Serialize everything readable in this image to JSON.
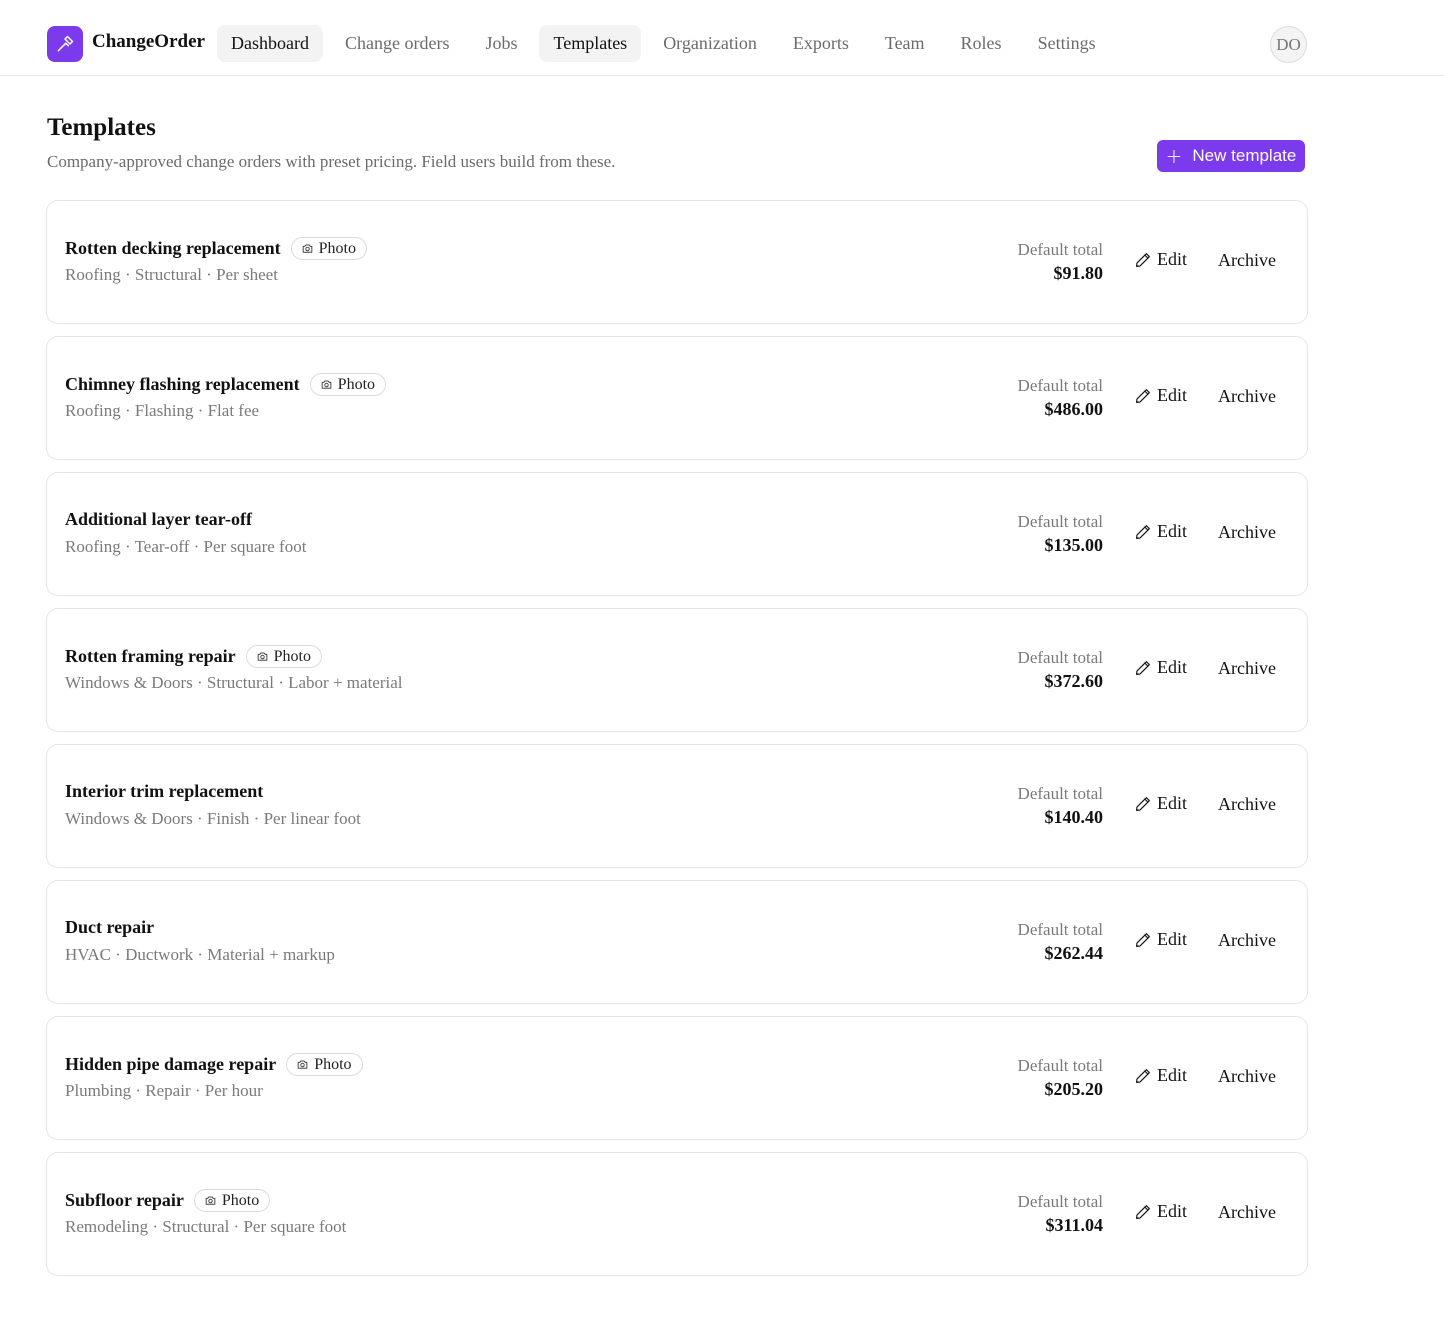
{
  "brand": {
    "name": "ChangeOrder",
    "logo_icon": "hammer-icon",
    "accent": "#7c3aed"
  },
  "nav": [
    {
      "label": "Dashboard",
      "active": true
    },
    {
      "label": "Change orders",
      "active": false
    },
    {
      "label": "Jobs",
      "active": false
    },
    {
      "label": "Templates",
      "active": true
    },
    {
      "label": "Organization",
      "active": false
    },
    {
      "label": "Exports",
      "active": false
    },
    {
      "label": "Team",
      "active": false
    },
    {
      "label": "Roles",
      "active": false
    },
    {
      "label": "Settings",
      "active": false
    }
  ],
  "user": {
    "initials": "DO"
  },
  "page": {
    "title": "Templates",
    "subtitle": "Company-approved change orders with preset pricing. Field users build from these.",
    "new_button": "New template"
  },
  "labels": {
    "default_total": "Default total",
    "edit": "Edit",
    "archive": "Archive",
    "photo": "Photo"
  },
  "templates": [
    {
      "name": "Rotten decking replacement",
      "photo": true,
      "meta": "Roofing · Structural · Per sheet",
      "total": "$91.80"
    },
    {
      "name": "Chimney flashing replacement",
      "photo": true,
      "meta": "Roofing · Flashing · Flat fee",
      "total": "$486.00"
    },
    {
      "name": "Additional layer tear-off",
      "photo": false,
      "meta": "Roofing · Tear-off · Per square foot",
      "total": "$135.00"
    },
    {
      "name": "Rotten framing repair",
      "photo": true,
      "meta": "Windows & Doors · Structural · Labor + material",
      "total": "$372.60"
    },
    {
      "name": "Interior trim replacement",
      "photo": false,
      "meta": "Windows & Doors · Finish · Per linear foot",
      "total": "$140.40"
    },
    {
      "name": "Duct repair",
      "photo": false,
      "meta": "HVAC · Ductwork · Material + markup",
      "total": "$262.44"
    },
    {
      "name": "Hidden pipe damage repair",
      "photo": true,
      "meta": "Plumbing · Repair · Per hour",
      "total": "$205.20"
    },
    {
      "name": "Subfloor repair",
      "photo": true,
      "meta": "Remodeling · Structural · Per square foot",
      "total": "$311.04"
    }
  ]
}
